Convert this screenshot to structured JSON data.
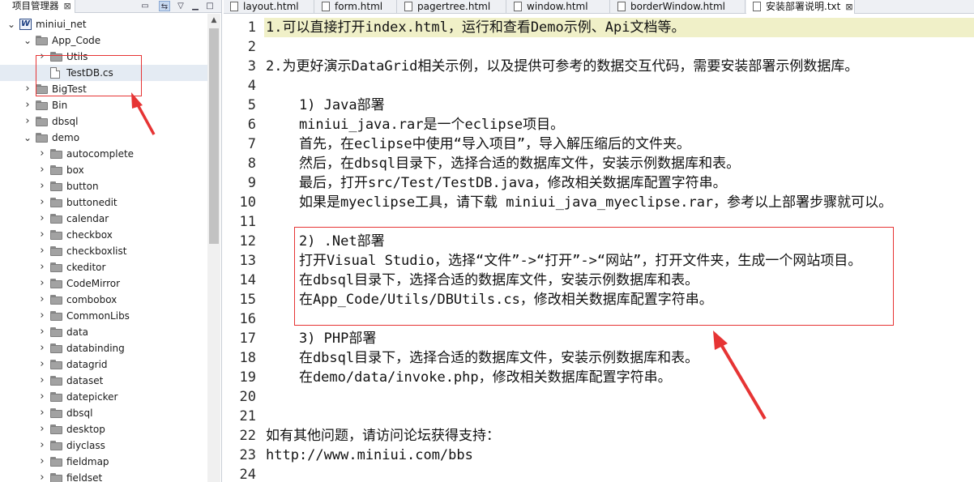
{
  "explorer": {
    "tab_label": "项目管理器",
    "close_glyph": "⊠",
    "tree": [
      {
        "label": "miniui_net",
        "level": 0,
        "kind": "project",
        "expanded": true
      },
      {
        "label": "App_Code",
        "level": 1,
        "kind": "folder",
        "expanded": true
      },
      {
        "label": "Utils",
        "level": 2,
        "kind": "folder",
        "expanded": false
      },
      {
        "label": "TestDB.cs",
        "level": 2,
        "kind": "file",
        "selected": true
      },
      {
        "label": "BigTest",
        "level": 1,
        "kind": "folder",
        "expanded": false
      },
      {
        "label": "Bin",
        "level": 1,
        "kind": "folder",
        "expanded": false
      },
      {
        "label": "dbsql",
        "level": 1,
        "kind": "folder",
        "expanded": false
      },
      {
        "label": "demo",
        "level": 1,
        "kind": "folder",
        "expanded": true
      },
      {
        "label": "autocomplete",
        "level": 2,
        "kind": "folder"
      },
      {
        "label": "box",
        "level": 2,
        "kind": "folder"
      },
      {
        "label": "button",
        "level": 2,
        "kind": "folder"
      },
      {
        "label": "buttonedit",
        "level": 2,
        "kind": "folder"
      },
      {
        "label": "calendar",
        "level": 2,
        "kind": "folder"
      },
      {
        "label": "checkbox",
        "level": 2,
        "kind": "folder"
      },
      {
        "label": "checkboxlist",
        "level": 2,
        "kind": "folder"
      },
      {
        "label": "ckeditor",
        "level": 2,
        "kind": "folder"
      },
      {
        "label": "CodeMirror",
        "level": 2,
        "kind": "folder"
      },
      {
        "label": "combobox",
        "level": 2,
        "kind": "folder"
      },
      {
        "label": "CommonLibs",
        "level": 2,
        "kind": "folder"
      },
      {
        "label": "data",
        "level": 2,
        "kind": "folder"
      },
      {
        "label": "databinding",
        "level": 2,
        "kind": "folder"
      },
      {
        "label": "datagrid",
        "level": 2,
        "kind": "folder"
      },
      {
        "label": "dataset",
        "level": 2,
        "kind": "folder"
      },
      {
        "label": "datepicker",
        "level": 2,
        "kind": "folder"
      },
      {
        "label": "dbsql",
        "level": 2,
        "kind": "folder"
      },
      {
        "label": "desktop",
        "level": 2,
        "kind": "folder"
      },
      {
        "label": "diyclass",
        "level": 2,
        "kind": "folder"
      },
      {
        "label": "fieldmap",
        "level": 2,
        "kind": "folder"
      },
      {
        "label": "fieldset",
        "level": 2,
        "kind": "folder"
      }
    ]
  },
  "editor": {
    "tabs": [
      {
        "label": "layout.html",
        "active": false
      },
      {
        "label": "form.html",
        "active": false
      },
      {
        "label": "pagertree.html",
        "active": false
      },
      {
        "label": "window.html",
        "active": false
      },
      {
        "label": "borderWindow.html",
        "active": false
      },
      {
        "label": "安装部署说明.txt",
        "active": true,
        "close": "⊠"
      }
    ],
    "lines": [
      "1.可以直接打开index.html，运行和查看Demo示例、Api文档等。",
      "",
      "2.为更好演示DataGrid相关示例，以及提供可参考的数据交互代码，需要安装部署示例数据库。",
      "",
      "    1) Java部署",
      "    miniui_java.rar是一个eclipse项目。",
      "    首先，在eclipse中使用“导入项目”，导入解压缩后的文件夹。",
      "    然后，在dbsql目录下，选择合适的数据库文件，安装示例数据库和表。",
      "    最后，打开src/Test/TestDB.java，修改相关数据库配置字符串。",
      "    如果是myeclipse工具，请下载 miniui_java_myeclipse.rar，参考以上部署步骤就可以。",
      "",
      "    2) .Net部署",
      "    打开Visual Studio，选择“文件”->“打开”->“网站”，打开文件夹，生成一个网站项目。",
      "    在dbsql目录下，选择合适的数据库文件，安装示例数据库和表。",
      "    在App_Code/Utils/DBUtils.cs，修改相关数据库配置字符串。",
      "",
      "    3) PHP部署",
      "    在dbsql目录下，选择合适的数据库文件，安装示例数据库和表。",
      "    在demo/data/invoke.php，修改相关数据库配置字符串。",
      "",
      "",
      "如有其他问题，请访问论坛获得支持：",
      "http://www.miniui.com/bbs",
      ""
    ]
  },
  "colors": {
    "current_line": "#f0f0c8",
    "annotation_red": "#e63434",
    "selection": "#e4ebf3"
  }
}
